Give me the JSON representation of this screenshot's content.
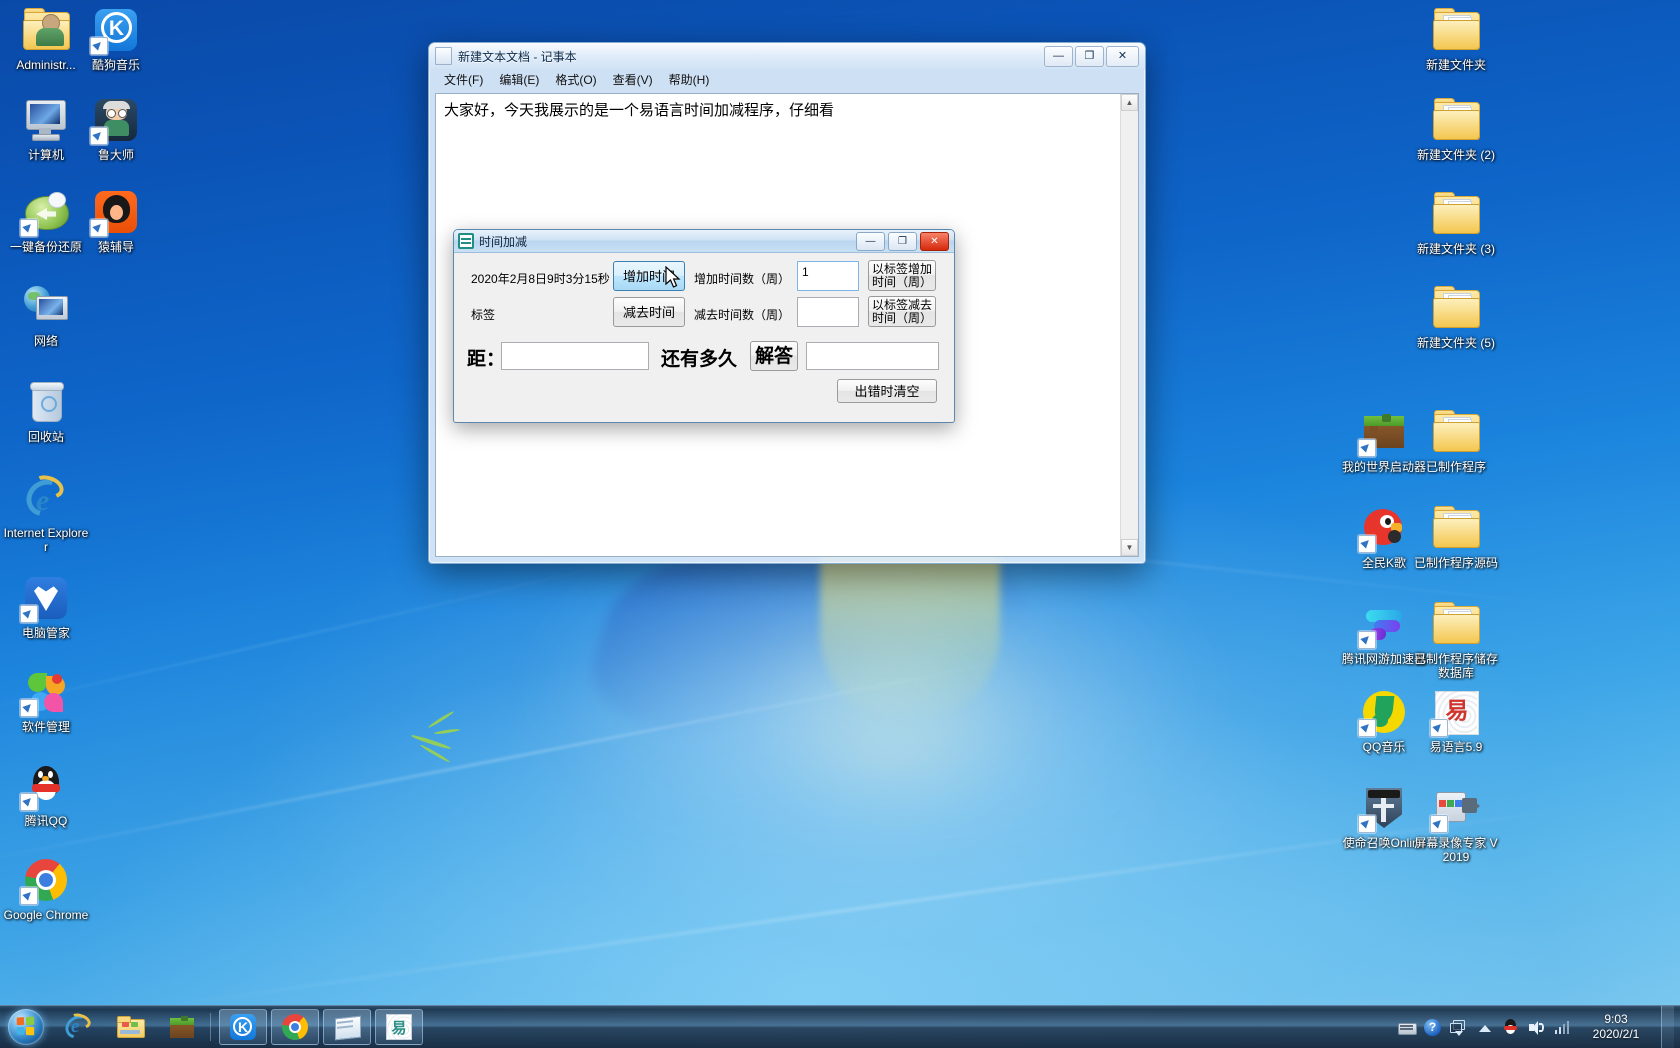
{
  "desktop": {
    "icons_left": [
      {
        "label": "Administr...",
        "icon": "user-folder-icon"
      },
      {
        "label": "酷狗音乐",
        "icon": "kugou-music-icon"
      },
      {
        "label": "计算机",
        "icon": "computer-icon"
      },
      {
        "label": "鲁大师",
        "icon": "ludashi-icon"
      },
      {
        "label": "一键备份还原",
        "icon": "backup-restore-icon"
      },
      {
        "label": "猿辅导",
        "icon": "yuanfudao-icon"
      },
      {
        "label": "网络",
        "icon": "network-icon"
      },
      {
        "label": "回收站",
        "icon": "recycle-bin-icon"
      },
      {
        "label": "Internet Explorer",
        "icon": "internet-explorer-icon"
      },
      {
        "label": "电脑管家",
        "icon": "pc-manager-icon"
      },
      {
        "label": "软件管理",
        "icon": "software-manager-icon"
      },
      {
        "label": "腾讯QQ",
        "icon": "tencent-qq-icon"
      },
      {
        "label": "Google Chrome",
        "icon": "google-chrome-icon"
      }
    ],
    "icons_right_col1": [
      {
        "label": "我的世界启动器",
        "icon": "minecraft-launcher-icon"
      },
      {
        "label": "全民K歌",
        "icon": "quanmin-ktv-icon"
      },
      {
        "label": "腾讯网游加速器",
        "icon": "tencent-game-accelerator-icon"
      },
      {
        "label": "QQ音乐",
        "icon": "qq-music-icon"
      },
      {
        "label": "使命召唤Online",
        "icon": "call-of-duty-online-icon"
      }
    ],
    "icons_right_col2": [
      {
        "label": "新建文件夹",
        "icon": "folder-icon"
      },
      {
        "label": "新建文件夹 (2)",
        "icon": "folder-icon"
      },
      {
        "label": "新建文件夹 (3)",
        "icon": "folder-icon"
      },
      {
        "label": "新建文件夹 (5)",
        "icon": "folder-icon"
      },
      {
        "label": "已制作程序",
        "icon": "folder-icon"
      },
      {
        "label": "已制作程序源码",
        "icon": "folder-icon"
      },
      {
        "label": "已制作程序储存数据库",
        "icon": "folder-icon"
      },
      {
        "label": "易语言5.9",
        "icon": "eyuyan-icon"
      },
      {
        "label": "屏幕录像专家 V2019",
        "icon": "screen-recorder-icon"
      }
    ]
  },
  "notepad": {
    "title": "新建文本文档 - 记事本",
    "menus": [
      "文件(F)",
      "编辑(E)",
      "格式(O)",
      "查看(V)",
      "帮助(H)"
    ],
    "content": "大家好，今天我展示的是一个易语言时间加减程序，仔细看",
    "minimize": "—",
    "maximize": "❐",
    "close": "✕",
    "scroll_up": "▲",
    "scroll_down": "▼"
  },
  "dialog": {
    "title": "时间加减",
    "minimize": "—",
    "maximize": "❐",
    "close": "✕",
    "current_time": "2020年2月8日9时3分15秒",
    "label_text": "标签",
    "add_time_button": "增加时间",
    "sub_time_button": "减去时间",
    "add_count_label": "增加时间数（周）",
    "sub_count_label": "减去时间数（周）",
    "add_count_value": "1",
    "sub_count_value": "",
    "add_by_label_button": "以标签增加时间（周）",
    "sub_by_label_button": "以标签减去时间（周）",
    "distance_label": "距：",
    "distance_value": "",
    "how_long_label": "还有多久",
    "answer_button": "解答",
    "answer_value": "",
    "clear_button": "出错时清空"
  },
  "taskbar": {
    "start_tooltip": "开始",
    "quick_launch": [
      {
        "name": "internet-explorer-icon"
      },
      {
        "name": "windows-explorer-icon"
      },
      {
        "name": "minecraft-icon"
      }
    ],
    "running": [
      {
        "name": "kugou-music-icon"
      },
      {
        "name": "google-chrome-icon"
      },
      {
        "name": "notepad-icon"
      },
      {
        "name": "eyuyan-icon"
      }
    ],
    "tray": [
      {
        "name": "keyboard-ime-icon"
      },
      {
        "name": "help-icon"
      },
      {
        "name": "window-switch-icon"
      },
      {
        "name": "show-hidden-icons-icon"
      },
      {
        "name": "tencent-qq-tray-icon"
      },
      {
        "name": "volume-icon"
      },
      {
        "name": "network-icon"
      }
    ],
    "clock_time": "9:03",
    "clock_date": "2020/2/1"
  },
  "colors": {
    "accent": "#1b84dd",
    "taskbar": "#1e3450",
    "dialog_face": "#f0f0f0",
    "focus_blue": "#3c7fb1",
    "close_red": "#d6290c"
  }
}
